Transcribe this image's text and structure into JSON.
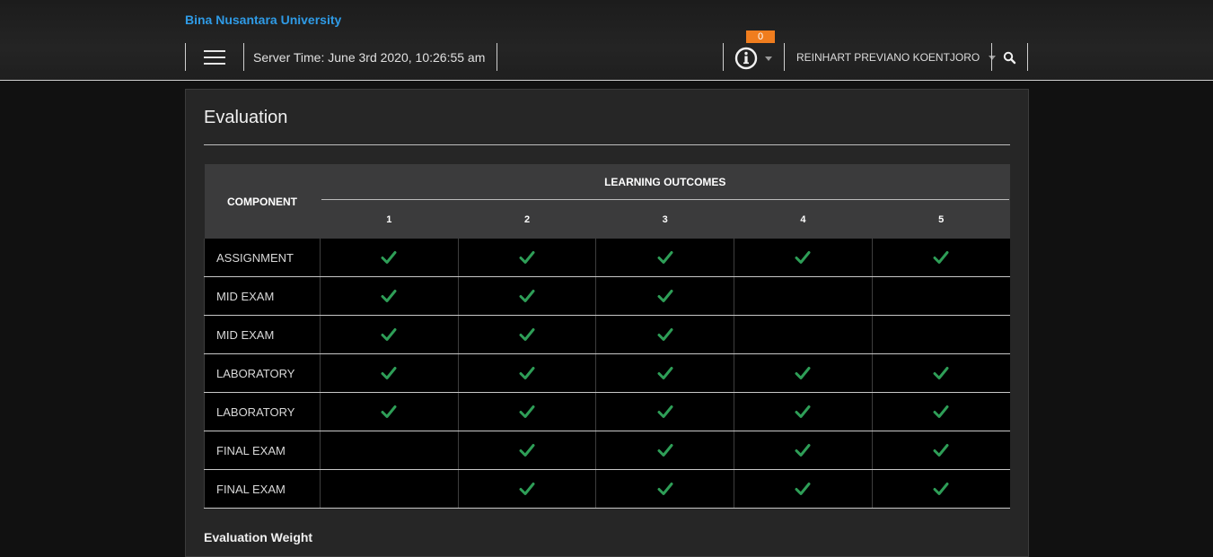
{
  "header": {
    "brand": "Bina Nusantara University",
    "server_time": "Server Time: June 3rd 2020, 10:26:55 am",
    "notification_count": "0",
    "user_name": "REINHART PREVIANO KOENTJORO",
    "icons": {
      "menu": "hamburger-menu-icon",
      "info": "info-circle-icon",
      "search": "search-icon"
    }
  },
  "panel": {
    "title": "Evaluation",
    "table": {
      "component_header": "COMPONENT",
      "outcomes_header": "LEARNING OUTCOMES",
      "outcome_numbers": [
        "1",
        "2",
        "3",
        "4",
        "5"
      ],
      "rows": [
        {
          "component": "ASSIGNMENT",
          "checks": [
            true,
            true,
            true,
            true,
            true
          ]
        },
        {
          "component": "MID EXAM",
          "checks": [
            true,
            true,
            true,
            false,
            false
          ]
        },
        {
          "component": "MID EXAM",
          "checks": [
            true,
            true,
            true,
            false,
            false
          ]
        },
        {
          "component": "LABORATORY",
          "checks": [
            true,
            true,
            true,
            true,
            true
          ]
        },
        {
          "component": "LABORATORY",
          "checks": [
            true,
            true,
            true,
            true,
            true
          ]
        },
        {
          "component": "FINAL EXAM",
          "checks": [
            false,
            true,
            true,
            true,
            true
          ]
        },
        {
          "component": "FINAL EXAM",
          "checks": [
            false,
            true,
            true,
            true,
            true
          ]
        }
      ]
    },
    "weight_title": "Evaluation Weight"
  },
  "colors": {
    "brand": "#2f9be6",
    "badge": "#f07d1e",
    "check": "#2e9e57",
    "header_bg": "#3b3b3c"
  }
}
